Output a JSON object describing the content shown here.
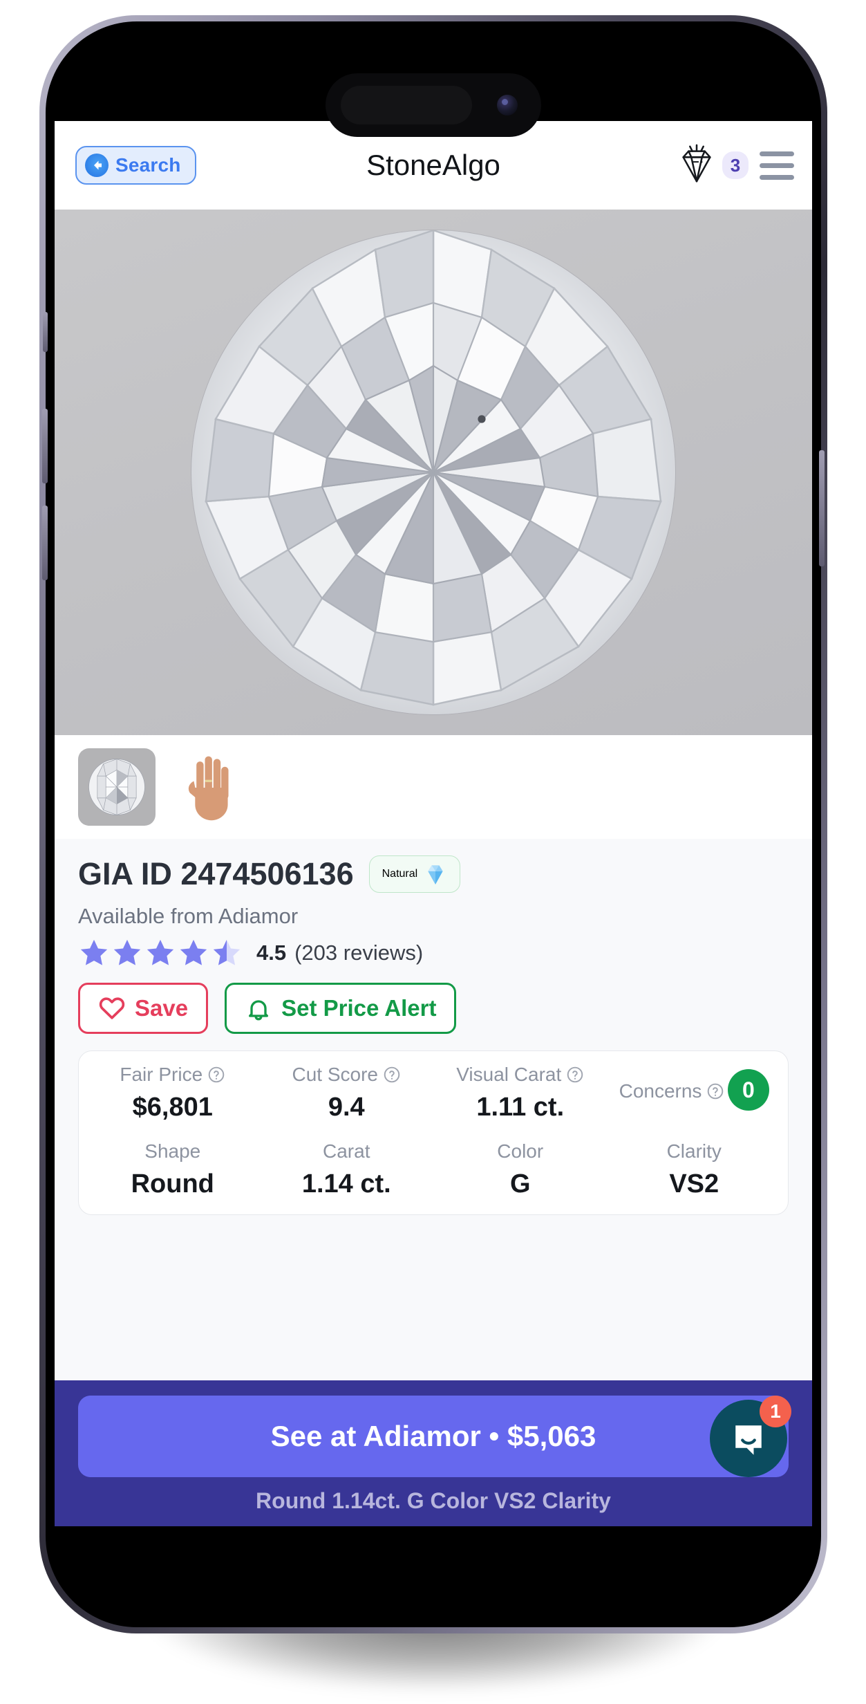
{
  "app": {
    "title": "StoneAlgo"
  },
  "header": {
    "back_button_label": "Search",
    "back_arrow_icon": "back-arrow-icon",
    "saved_diamonds_icon": "diamond-icon",
    "saved_diamonds_count": "3",
    "menu_icon": "hamburger-menu-icon"
  },
  "gallery": {
    "main_image_alt": "round-brilliant-diamond",
    "thumbnails": [
      {
        "name": "diamond-thumbnail",
        "selected": true
      },
      {
        "name": "hand-thumbnail",
        "selected": false
      }
    ]
  },
  "detail": {
    "title": "GIA ID 2474506136",
    "badge": {
      "label": "Natural",
      "icon": "diamond-gem-icon"
    },
    "availability": "Available from Adiamor",
    "rating": {
      "stars": 4.5,
      "value": "4.5",
      "reviews": "(203 reviews)"
    },
    "actions": {
      "save_label": "Save",
      "save_icon": "heart-icon",
      "price_alert_label": "Set Price Alert",
      "price_alert_icon": "bell-icon"
    }
  },
  "stats": {
    "row1": [
      {
        "label": "Fair Price",
        "value": "$6,801",
        "help": true
      },
      {
        "label": "Cut Score",
        "value": "9.4",
        "help": true
      },
      {
        "label": "Visual Carat",
        "value": "1.11 ct.",
        "help": true
      },
      {
        "label": "Concerns",
        "value": "0",
        "help": true,
        "pill": true
      }
    ],
    "row2": [
      {
        "label": "Shape",
        "value": "Round"
      },
      {
        "label": "Carat",
        "value": "1.14 ct."
      },
      {
        "label": "Color",
        "value": "G"
      },
      {
        "label": "Clarity",
        "value": "VS2"
      }
    ]
  },
  "cta": {
    "button_label": "See at Adiamor  •  $5,063",
    "subtitle": "Round 1.14ct. G Color VS2 Clarity"
  },
  "intercom": {
    "icon": "chat-bubble-icon",
    "unread_count": "1"
  },
  "colors": {
    "accent_blue": "#3b7af0",
    "save_red": "#e53e5c",
    "alert_green": "#139a47",
    "natural_green": "#14a34a",
    "concerns_green": "#12a150",
    "cta_bar_purple": "#383596",
    "cta_button_purple": "#6668ee",
    "intercom_teal": "#0b4c5f",
    "intercom_badge_red": "#f4614d",
    "star_purple": "#7b7ff0",
    "badge_lavender": "#ece9fb"
  }
}
